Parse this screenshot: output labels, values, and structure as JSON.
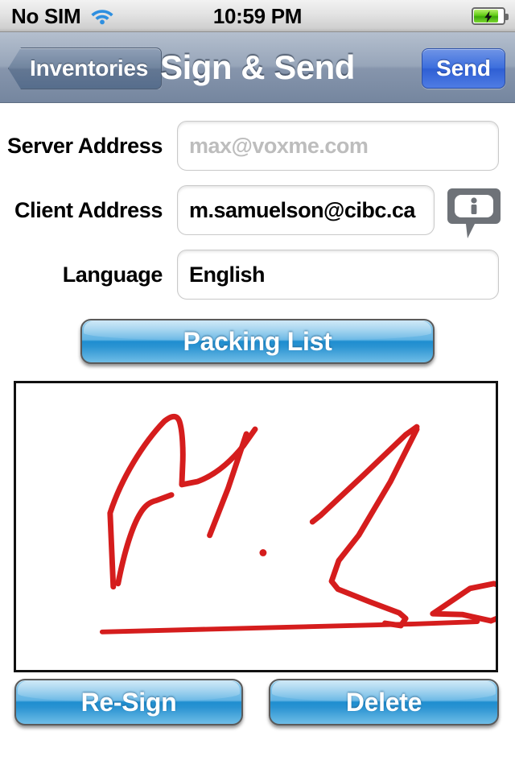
{
  "status_bar": {
    "carrier": "No SIM",
    "wifi_icon": "wifi-icon",
    "time": "10:59 PM",
    "battery_icon": "battery-charging-icon"
  },
  "nav_bar": {
    "back_label": "Inventories",
    "title": "Sign & Send",
    "send_label": "Send",
    "bar_color": "#8695ac",
    "send_color": "#3d6fdd"
  },
  "form": {
    "rows": [
      {
        "label": "Server Address",
        "value": "",
        "placeholder": "max@voxme.com",
        "is_placeholder": true
      },
      {
        "label": "Client Address",
        "value": "m.samuelson@cibc.ca",
        "placeholder": "",
        "is_placeholder": false
      },
      {
        "label": "Language",
        "value": "English",
        "placeholder": "",
        "is_placeholder": false
      }
    ],
    "info_icon": "info-bubble-icon"
  },
  "actions": {
    "packing_list_label": "Packing List",
    "resign_label": "Re-Sign",
    "delete_label": "Delete",
    "button_color": "#1e8ed0"
  },
  "signature": {
    "ink_color": "#d51d1d",
    "background": "#ffffff",
    "border_color": "#111111"
  }
}
